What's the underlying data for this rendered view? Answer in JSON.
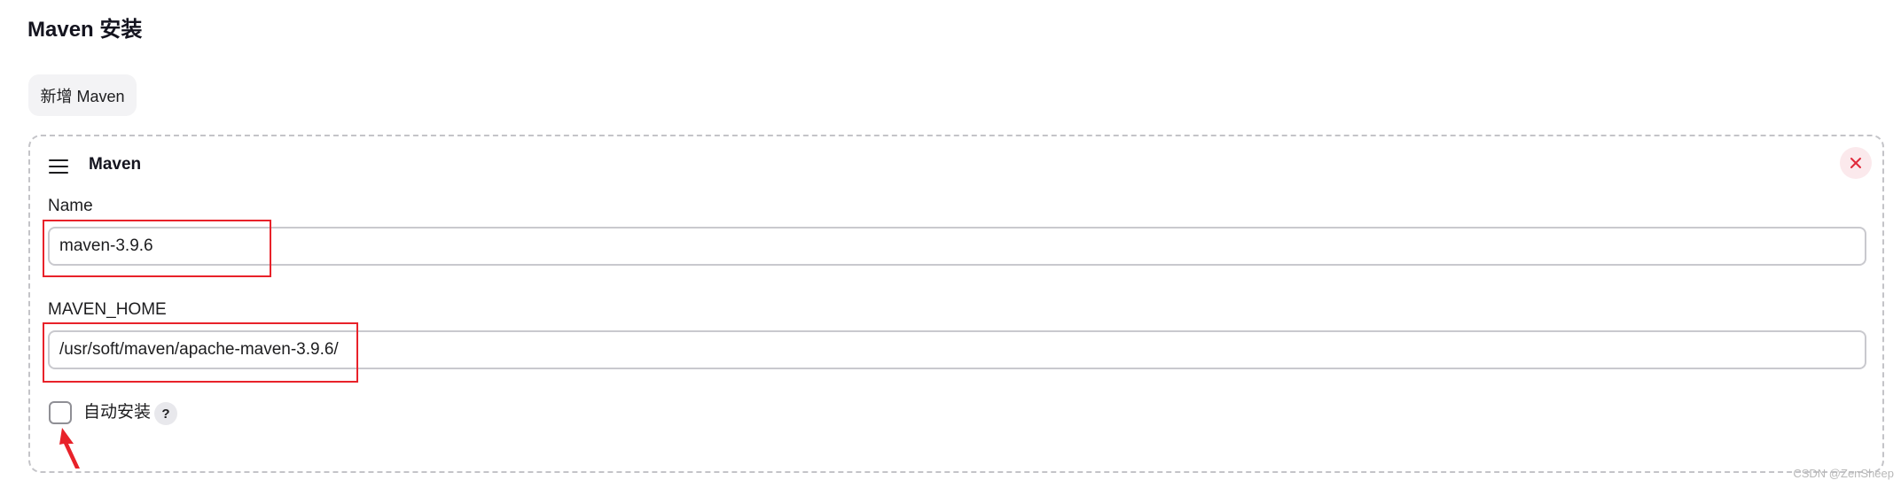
{
  "section": {
    "title": "Maven 安装"
  },
  "add_button": {
    "label": "新增 Maven"
  },
  "installation": {
    "title": "Maven",
    "fields": {
      "name": {
        "label": "Name",
        "value": "maven-3.9.6"
      },
      "home": {
        "label": "MAVEN_HOME",
        "value": "/usr/soft/maven/apache-maven-3.9.6/"
      }
    },
    "auto_install": {
      "label": "自动安装",
      "checked": false,
      "help": "?"
    }
  },
  "colors": {
    "highlight": "#e8222a",
    "delete": "#e02a3c",
    "delete_bg": "#fbe9ec"
  },
  "icons": {
    "drag": "drag-handle-icon",
    "close": "close-icon",
    "help": "help-icon",
    "arrow": "arrow-icon"
  },
  "watermark": "CSDN @ZenSheep"
}
